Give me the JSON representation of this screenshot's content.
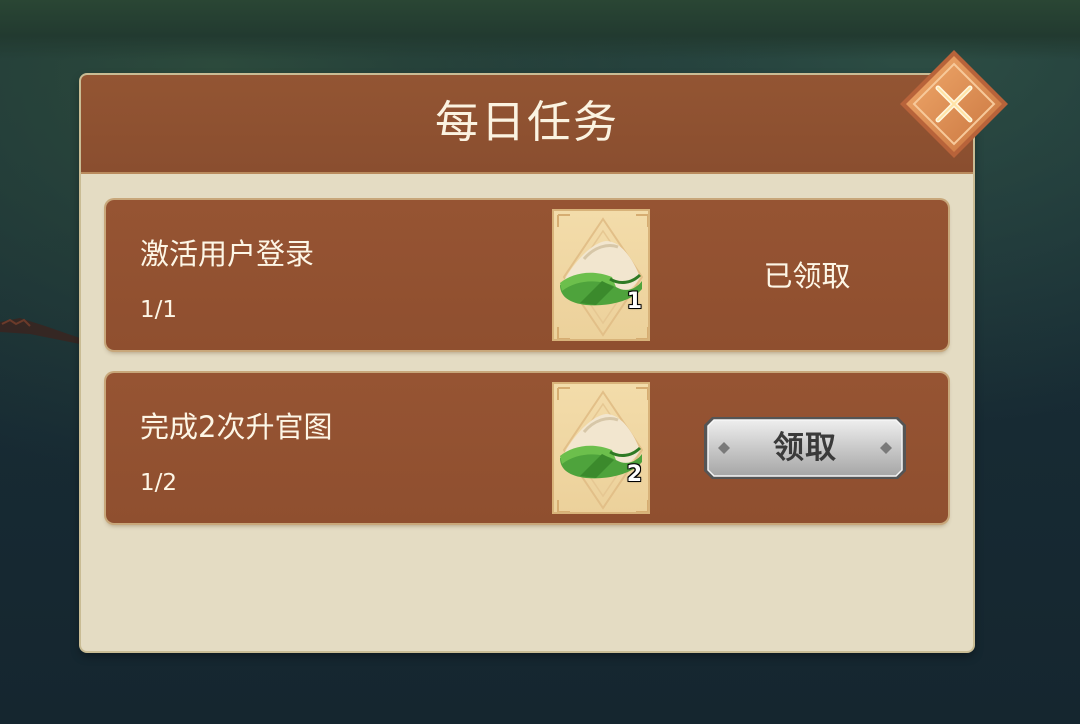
{
  "dialog": {
    "title": "每日任务"
  },
  "tasks": [
    {
      "name": "激活用户登录",
      "progress": "1/1",
      "reward": {
        "icon": "zongzi-icon",
        "count": "1"
      },
      "status": "claimed",
      "status_label": "已领取"
    },
    {
      "name": "完成2次升官图",
      "progress": "1/2",
      "reward": {
        "icon": "zongzi-icon",
        "count": "2"
      },
      "status": "claimable",
      "button_label": "领取"
    }
  ],
  "colors": {
    "header_brown": "#8f5131",
    "panel_cream": "#e4dcc3",
    "row_brown": "#935233",
    "close_orange": "#d88a55",
    "button_silver": "#bfbfbf"
  }
}
